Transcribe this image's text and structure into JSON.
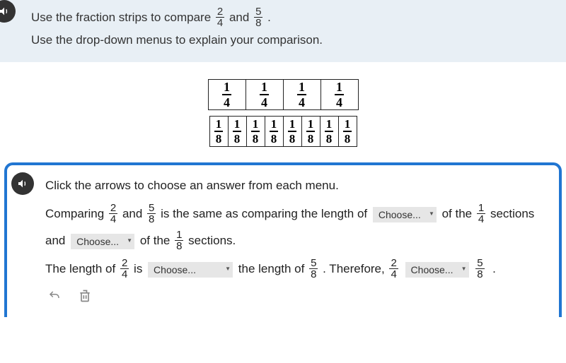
{
  "prompt": {
    "line1_a": "Use the fraction strips to compare ",
    "line1_b": " and ",
    "line1_c": ".",
    "line2": "Use the drop-down menus to explain your comparison.",
    "frac1": {
      "n": "2",
      "d": "4"
    },
    "frac2": {
      "n": "5",
      "d": "8"
    }
  },
  "strips": {
    "row1": {
      "n": "1",
      "d": "4",
      "count": 4
    },
    "row2": {
      "n": "1",
      "d": "8",
      "count": 8
    }
  },
  "response": {
    "instruction": "Click the arrows to choose an answer from each menu.",
    "t1": "Comparing ",
    "t2": " and ",
    "t3": " is the same as comparing the length of ",
    "t4": " of the ",
    "t5": " sections and ",
    "t6": " of the ",
    "t7": " sections.",
    "t8": "The length of ",
    "t9": " is ",
    "t10": " the length of ",
    "t11": ". Therefore, ",
    "t12": " ",
    "t13": " .",
    "fracA": {
      "n": "2",
      "d": "4"
    },
    "fracB": {
      "n": "5",
      "d": "8"
    },
    "fracQ4": {
      "n": "1",
      "d": "4"
    },
    "fracQ8": {
      "n": "1",
      "d": "8"
    }
  },
  "dropdowns": {
    "choose": "Choose..."
  }
}
